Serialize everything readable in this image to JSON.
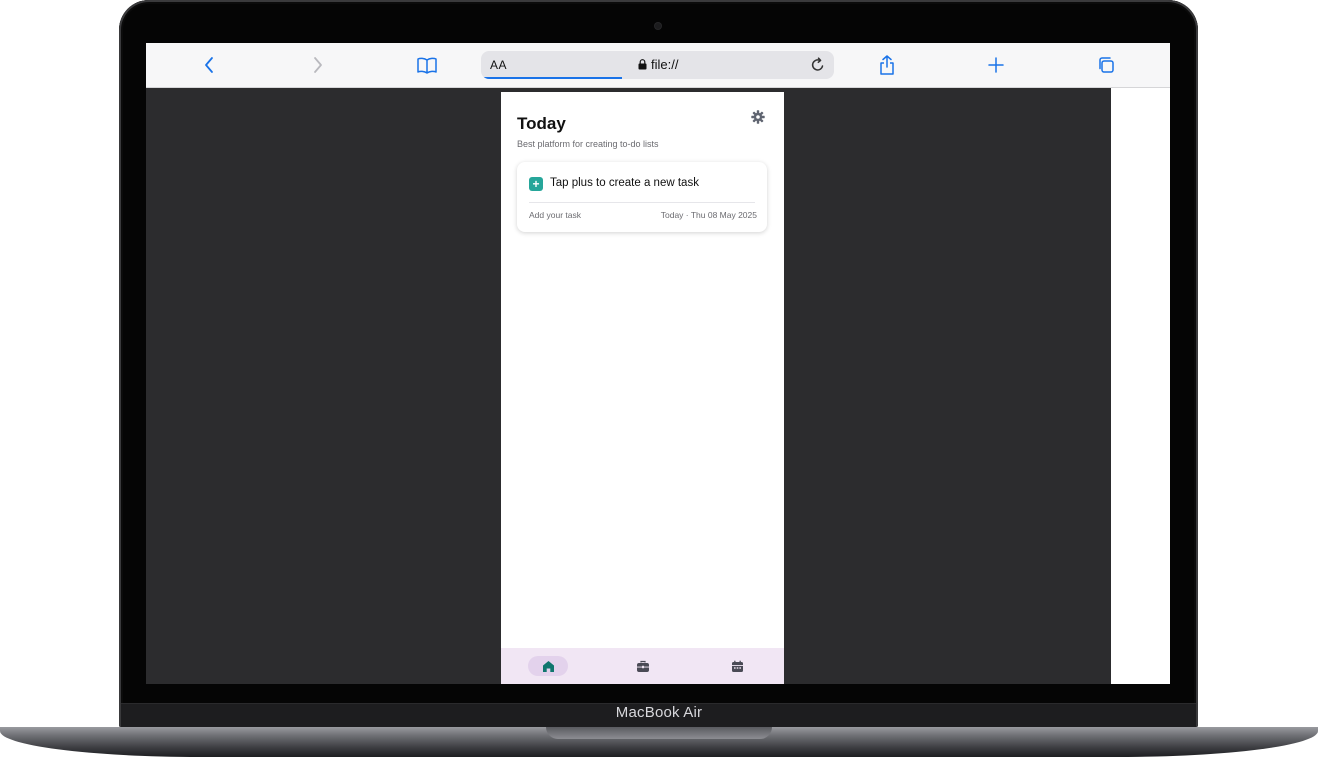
{
  "device": {
    "model_label": "MacBook Air"
  },
  "browser": {
    "toolbar": {
      "back_icon": "chevron-left-icon",
      "forward_icon": "chevron-right-icon",
      "bookmarks_icon": "book-icon",
      "share_icon": "share-icon",
      "new_tab_icon": "plus-icon",
      "tabs_icon": "tabs-icon"
    },
    "address_bar": {
      "reader_label": "AA",
      "url": "file://",
      "secure": true,
      "load_progress": 0.4
    },
    "accent_color": "#1a73e8"
  },
  "app": {
    "title": "Today",
    "subtitle": "Best platform for creating to-do lists",
    "task_card": {
      "prompt": "Tap plus to create a new task",
      "add_label": "Add your task",
      "date_label": "Today · Thu 08 May 2025",
      "accent_color": "#26a69a"
    },
    "bottom_nav": {
      "items": [
        {
          "icon": "home-icon",
          "active": true
        },
        {
          "icon": "briefcase-icon",
          "active": false
        },
        {
          "icon": "calendar-icon",
          "active": false
        }
      ],
      "background_color": "#f1e6f4"
    }
  }
}
